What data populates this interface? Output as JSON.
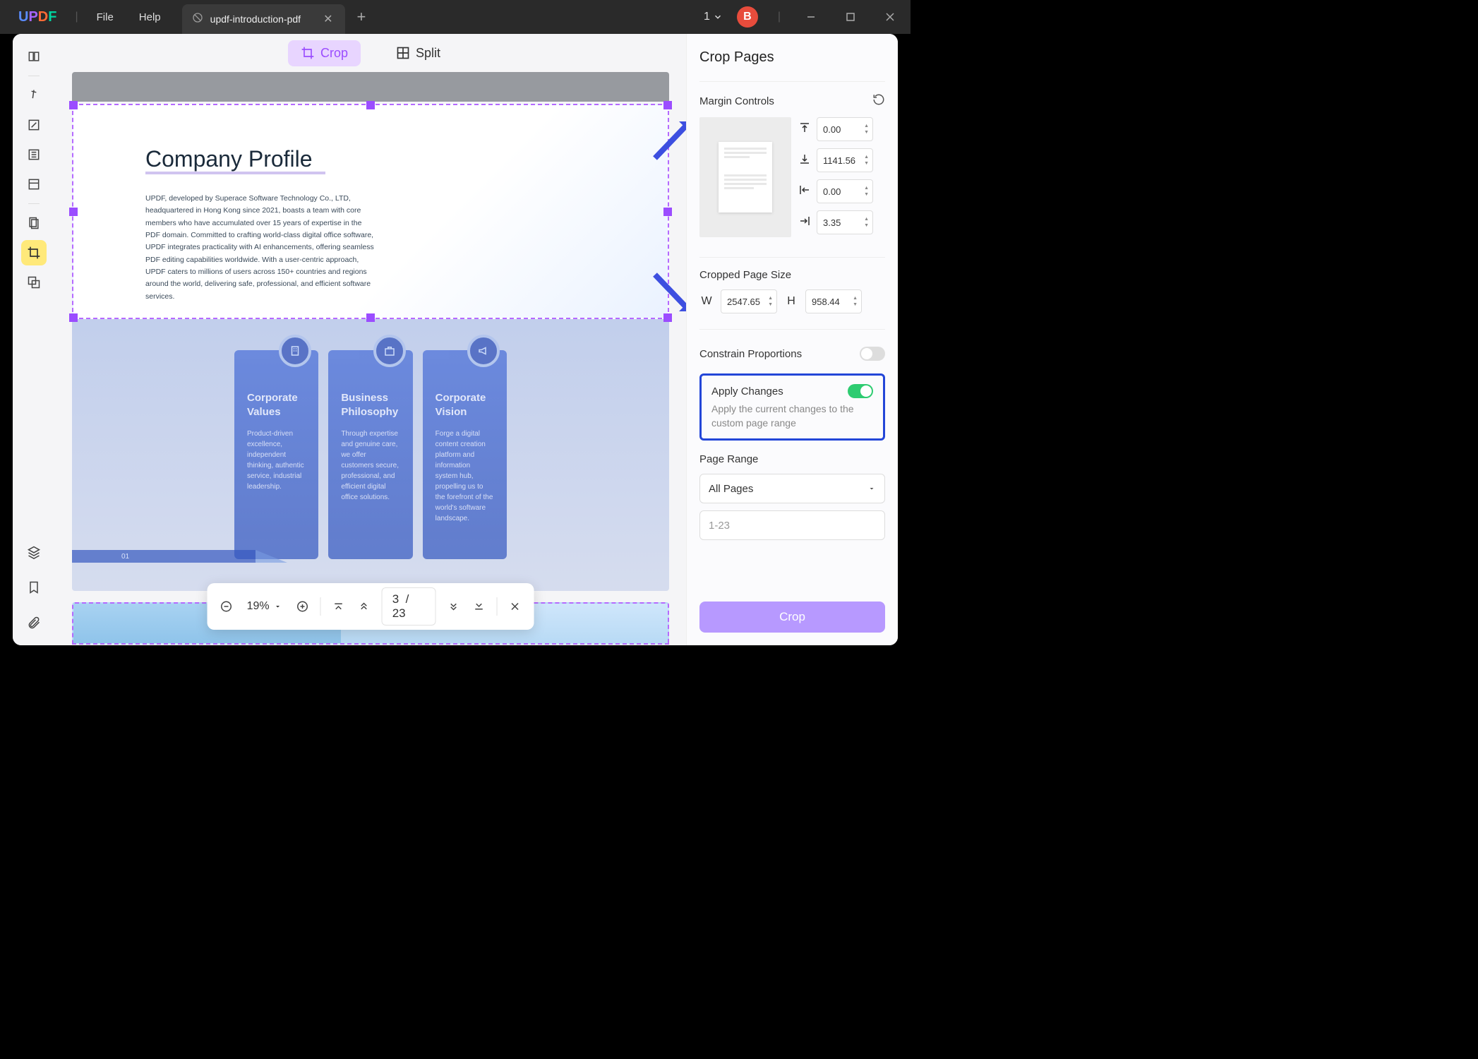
{
  "titlebar": {
    "menu_file": "File",
    "menu_help": "Help",
    "tab_title": "updf-introduction-pdf",
    "doc_count": "1",
    "avatar_letter": "B"
  },
  "modes": {
    "crop": "Crop",
    "split": "Split"
  },
  "doc": {
    "title": "Company Profile",
    "para": "UPDF, developed by Superace Software Technology Co., LTD, headquartered in Hong Kong since 2021, boasts a team with core members who have accumulated over 15 years of expertise in the PDF domain. Committed to crafting world-class digital office software, UPDF integrates practicality with AI enhancements, offering seamless PDF editing capabilities worldwide. With a user-centric approach, UPDF caters to millions of users across 150+ countries and regions around the world, delivering safe, professional, and efficient software services.",
    "page_num_footer": "01",
    "cards": [
      {
        "title": "Corporate Values",
        "body": "Product-driven excellence, independent thinking, authentic service, industrial leadership."
      },
      {
        "title": "Business Philosophy",
        "body": "Through expertise and genuine care, we offer customers secure, professional, and efficient digital office solutions."
      },
      {
        "title": "Corporate Vision",
        "body": "Forge a digital content creation platform and information system hub, propelling us to the forefront of the world's software landscape."
      }
    ]
  },
  "footbar": {
    "zoom": "19%",
    "page_cur": "3",
    "page_sep": "/",
    "page_total": "23"
  },
  "panel": {
    "title": "Crop Pages",
    "margin_controls": "Margin Controls",
    "margin_top": "0.00",
    "margin_bottom": "1141.56",
    "margin_left": "0.00",
    "margin_right": "3.35",
    "cropped_size": "Cropped Page Size",
    "w_label": "W",
    "w_value": "2547.65",
    "h_label": "H",
    "h_value": "958.44",
    "constrain": "Constrain Proportions",
    "apply_title": "Apply Changes",
    "apply_desc": "Apply the current changes to the custom page range",
    "page_range": "Page Range",
    "range_select": "All Pages",
    "range_placeholder": "1-23",
    "crop_btn": "Crop"
  }
}
